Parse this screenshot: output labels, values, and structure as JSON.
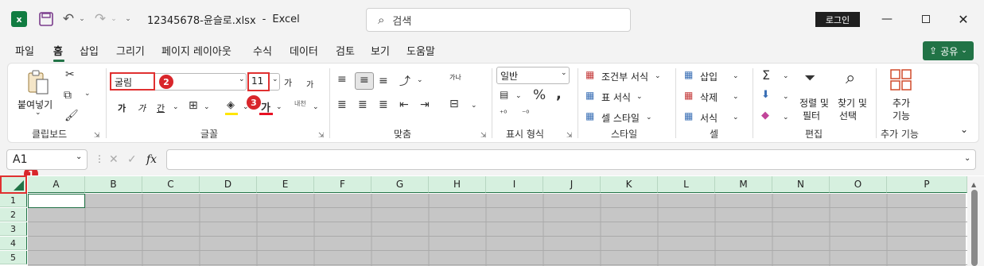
{
  "titlebar": {
    "filename": "12345678-윤슬로.xlsx",
    "separator": "-",
    "app": "Excel",
    "search_placeholder": "검색",
    "login": "로그인"
  },
  "menu": {
    "items": [
      "파일",
      "홈",
      "삽입",
      "그리기",
      "페이지 레이아웃",
      "수식",
      "데이터",
      "검토",
      "보기",
      "도움말"
    ],
    "share": "공유"
  },
  "ribbon": {
    "clipboard": {
      "paste": "붙여넣기",
      "label": "클립보드"
    },
    "font": {
      "name": "굴림",
      "size": "11",
      "label": "글꼴",
      "bold": "가",
      "italic": "가",
      "underline": "간",
      "grow": "가",
      "shrink": "가",
      "phonetic": "내천"
    },
    "align": {
      "label": "맞춤",
      "wrap": "가나"
    },
    "number": {
      "format": "일반",
      "label": "표시 형식"
    },
    "style": {
      "cond": "조건부 서식",
      "table": "표 서식",
      "cell": "셀 스타일",
      "label": "스타일"
    },
    "cells": {
      "insert": "삽입",
      "delete": "삭제",
      "format": "서식",
      "label": "셀"
    },
    "edit": {
      "sort1": "정렬 및",
      "sort2": "필터",
      "find1": "찾기 및",
      "find2": "선택",
      "label": "편집"
    },
    "addin": {
      "a1": "추가",
      "a2": "기능",
      "label": "추가 기능"
    }
  },
  "markers": [
    "1",
    "2",
    "3"
  ],
  "formula_bar": {
    "namebox": "A1",
    "fx": "fx"
  },
  "sheet": {
    "columns": [
      "A",
      "B",
      "C",
      "D",
      "E",
      "F",
      "G",
      "H",
      "I",
      "J",
      "K",
      "L",
      "M",
      "N",
      "O",
      "P"
    ],
    "rows": [
      "1",
      "2",
      "3",
      "4",
      "5"
    ]
  },
  "colors": {
    "accent": "#217346",
    "marker": "#d9262b"
  }
}
